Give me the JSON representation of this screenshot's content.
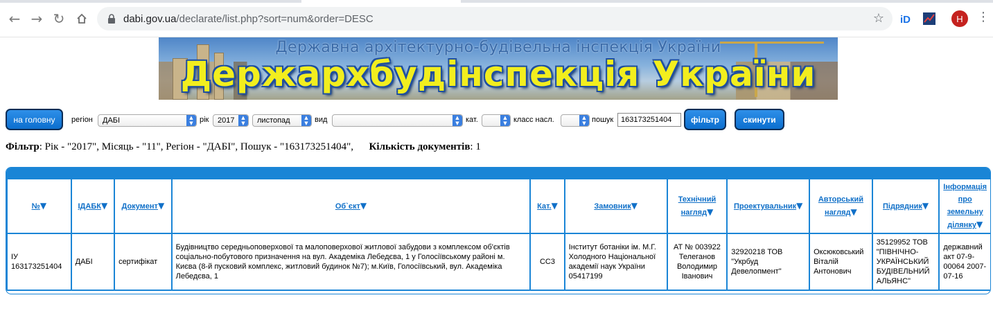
{
  "browser": {
    "url_host": "dabi.gov.ua",
    "url_path": "/declarate/list.php?sort=num&order=DESC",
    "profile_initial": "H"
  },
  "banner": {
    "subtitle": "Державна архітектурно-будівельна інспекція України",
    "title": "Держархбудінспекція України"
  },
  "filters": {
    "home_button": "на головну",
    "region_label": "регіон",
    "region_value": "ДАБІ",
    "year_label": "рік",
    "year_value": "2017",
    "month_value": "листопад",
    "type_label": "вид",
    "type_value": "",
    "cat_label": "кат.",
    "cat_value": "",
    "class_label": "класс насл.",
    "class_value": "",
    "search_label": "пошук",
    "search_value": "163173251404",
    "filter_button": "фільтр",
    "reset_button": "скинути"
  },
  "summary": {
    "filter_label": "Фільтр",
    "filter_text": ": Рік - \"2017\", Місяць - \"11\", Регіон - \"ДАБІ\", Пошук - \"163173251404\",",
    "count_label": "Кількість документів",
    "count_value": ": 1"
  },
  "table": {
    "columns": [
      "№",
      "ІДАБК",
      "Документ",
      "Об`єкт",
      "Кат.",
      "Замовник",
      "Технічний нагляд",
      "Проектувальник",
      "Авторський нагляд",
      "Підрядник",
      "Інформація про земельну ділянку"
    ],
    "rows": [
      {
        "num": "ІУ 163173251404",
        "idabk": "ДАБІ",
        "document": "сертифікат",
        "object": "Будівництво середньоповерхової та малоповерхової житлової забудови з комплексом об'єктів соціально-побутового призначення на вул. Академіка Лебедєва, 1 у Голосіївському районі м. Києва (8-й пусковий комплекс, житловий будинок №7); м.Київ, Голосіївський, вул. Академіка Лебедєва, 1",
        "cat": "СС3",
        "customer": "Інститут ботаніки ім. М.Г. Холодного Національної академії наук України 05417199",
        "tech_supervision": "АТ № 003922 Телеганов Володимир Іванович",
        "designer": "32920218 ТОВ \"Укрбуд Девелопмент\"",
        "author_supervision": "Оксюковський Віталій Антонович",
        "contractor": "35129952 ТОВ \"ПІВНІЧНО-УКРАЇНСЬКИЙ БУДІВЕЛЬНИЙ АЛЬЯНС\"",
        "land_info": "державний акт 07-9-00064 2007-07-16"
      }
    ]
  },
  "colors": {
    "accent": "#1a85d6",
    "button": "#0c6fcf",
    "banner_title": "#f2ee1e"
  }
}
